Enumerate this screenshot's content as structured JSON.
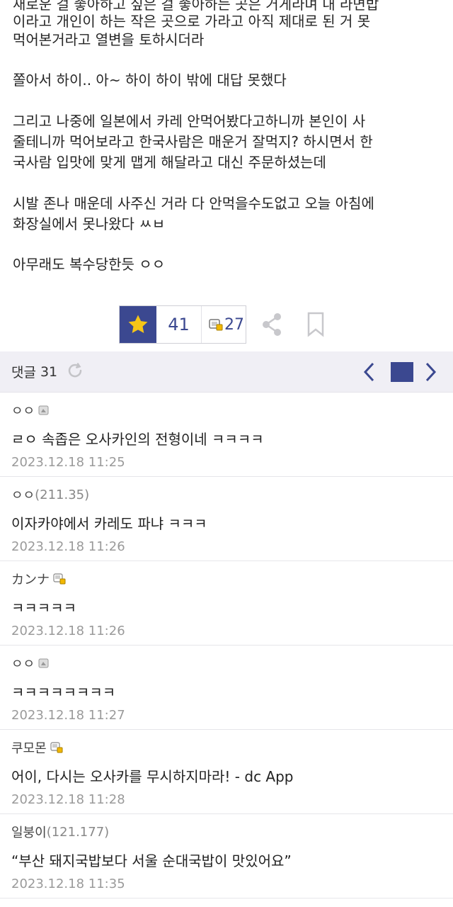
{
  "article": {
    "lines": [
      "새로운 걸 좋아하고 싶은 걸 좋아하는 곳은 거게라며 내 라면밥",
      "이라고 개인이 하는 작은 곳으로 가라고 아직 제대로 된 거 못",
      "먹어본거라고 열변을 토하시더라",
      "쫄아서 하이.. 아~ 하이 하이 밖에 대답 못했다",
      "그리고 나중에 일본에서 카레 안먹어봤다고하니까 본인이 사",
      "줄테니까 먹어보라고 한국사람은 매운거 잘먹지? 하시면서 한",
      "국사람 입맛에 맞게 맵게 해달라고 대신 주문하셨는데",
      "시발 존나 매운데 사주신 거라 다 안먹을수도없고 오늘 아침에",
      "화장실에서 못나왔다 ㅆㅂ",
      "아무래도 복수당한듯 ㅇㅇ"
    ]
  },
  "vote": {
    "recommend_count": "41",
    "fixed_count": "27",
    "colors": {
      "accent": "#3b4890",
      "star": "#f5c518"
    }
  },
  "comments_header": {
    "title": "댓글",
    "count": "31"
  },
  "comments": [
    {
      "author": "ㅇㅇ",
      "ip": "",
      "badge": "gray-user-icon",
      "text": "ㄹㅇ 속좁은 오사카인의 전형이네 ㅋㅋㅋㅋ",
      "date": "2023.12.18 11:25"
    },
    {
      "author": "ㅇㅇ",
      "ip": "(211.35)",
      "badge": "",
      "text": "이자카야에서 카레도 파냐 ㅋㅋㅋ",
      "date": "2023.12.18 11:26"
    },
    {
      "author": "カンナ",
      "ip": "",
      "badge": "fixed-user-icon",
      "text": "ㅋㅋㅋㅋㅋ",
      "date": "2023.12.18 11:26"
    },
    {
      "author": "ㅇㅇ",
      "ip": "",
      "badge": "gray-user-icon",
      "text": "ㅋㅋㅋㅋㅋㅋㅋㅋ",
      "date": "2023.12.18 11:27"
    },
    {
      "author": "쿠모몬",
      "ip": "",
      "badge": "fixed-user-icon",
      "text": "어이, 다시는 오사카를 무시하지마라! - dc App",
      "date": "2023.12.18 11:28"
    },
    {
      "author": "일붕이",
      "ip": "(121.177)",
      "badge": "",
      "text": "“부산 돼지국밥보다 서울 순대국밥이 맛있어요”",
      "date": "2023.12.18 11:35"
    }
  ]
}
